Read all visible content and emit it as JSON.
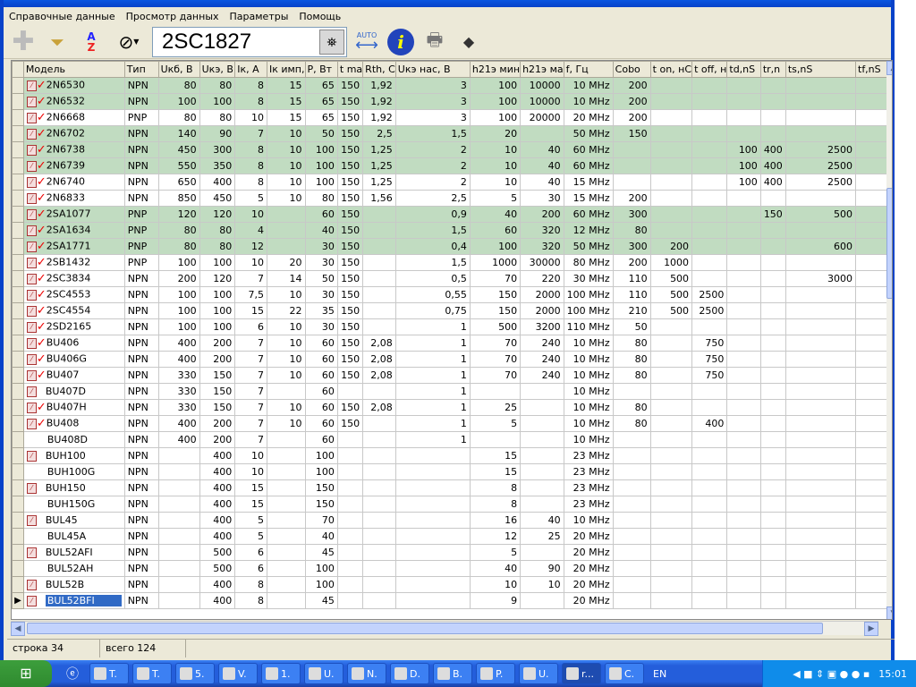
{
  "menu": [
    "Справочные данные",
    "Просмотр данных",
    "Параметры",
    "Помощь"
  ],
  "search": {
    "value": "2SC1827"
  },
  "toolbar": {
    "auto_label": "AUTO"
  },
  "columns": [
    "Модель",
    "Тип",
    "Uкб, В",
    "Uкэ, В",
    "Iк, А",
    "Iк имп,",
    "P, Вт",
    "t ma",
    "Rth, C",
    "Uкэ нас, В",
    "h21э мин",
    "h21э ма",
    "f, Гц",
    "Cobo",
    "t on, нС",
    "t off, н",
    "td,nS",
    "tr,n",
    "ts,nS",
    "tf,nS"
  ],
  "rows": [
    {
      "g": 1,
      "pdf": 1,
      "chk": 1,
      "c": [
        "2N6530",
        "NPN",
        "80",
        "80",
        "8",
        "15",
        "65",
        "150",
        "1,92",
        "3",
        "100",
        "10000",
        "10 MHz",
        "200",
        "",
        "",
        "",
        "",
        "",
        ""
      ]
    },
    {
      "g": 1,
      "pdf": 1,
      "chk": 1,
      "c": [
        "2N6532",
        "NPN",
        "100",
        "100",
        "8",
        "15",
        "65",
        "150",
        "1,92",
        "3",
        "100",
        "10000",
        "10 MHz",
        "200",
        "",
        "",
        "",
        "",
        "",
        ""
      ]
    },
    {
      "g": 0,
      "pdf": 1,
      "chk": 1,
      "c": [
        "2N6668",
        "PNP",
        "80",
        "80",
        "10",
        "15",
        "65",
        "150",
        "1,92",
        "3",
        "100",
        "20000",
        "20 MHz",
        "200",
        "",
        "",
        "",
        "",
        "",
        ""
      ]
    },
    {
      "g": 1,
      "pdf": 1,
      "chk": 1,
      "c": [
        "2N6702",
        "NPN",
        "140",
        "90",
        "7",
        "10",
        "50",
        "150",
        "2,5",
        "1,5",
        "20",
        "",
        "50 MHz",
        "150",
        "",
        "",
        "",
        "",
        "",
        ""
      ]
    },
    {
      "g": 1,
      "pdf": 1,
      "chk": 1,
      "c": [
        "2N6738",
        "NPN",
        "450",
        "300",
        "8",
        "10",
        "100",
        "150",
        "1,25",
        "2",
        "10",
        "40",
        "60 MHz",
        "",
        "",
        "",
        "100",
        "400",
        "2500",
        ""
      ]
    },
    {
      "g": 1,
      "pdf": 1,
      "chk": 1,
      "c": [
        "2N6739",
        "NPN",
        "550",
        "350",
        "8",
        "10",
        "100",
        "150",
        "1,25",
        "2",
        "10",
        "40",
        "60 MHz",
        "",
        "",
        "",
        "100",
        "400",
        "2500",
        ""
      ]
    },
    {
      "g": 0,
      "pdf": 1,
      "chk": 1,
      "c": [
        "2N6740",
        "NPN",
        "650",
        "400",
        "8",
        "10",
        "100",
        "150",
        "1,25",
        "2",
        "10",
        "40",
        "15 MHz",
        "",
        "",
        "",
        "100",
        "400",
        "2500",
        ""
      ]
    },
    {
      "g": 0,
      "pdf": 1,
      "chk": 1,
      "c": [
        "2N6833",
        "NPN",
        "850",
        "450",
        "5",
        "10",
        "80",
        "150",
        "1,56",
        "2,5",
        "5",
        "30",
        "15 MHz",
        "200",
        "",
        "",
        "",
        "",
        "",
        ""
      ]
    },
    {
      "g": 1,
      "pdf": 1,
      "chk": 1,
      "c": [
        "2SA1077",
        "PNP",
        "120",
        "120",
        "10",
        "",
        "60",
        "150",
        "",
        "0,9",
        "40",
        "200",
        "60 MHz",
        "300",
        "",
        "",
        "",
        "150",
        "500",
        ""
      ]
    },
    {
      "g": 1,
      "pdf": 1,
      "chk": 1,
      "c": [
        "2SA1634",
        "PNP",
        "80",
        "80",
        "4",
        "",
        "40",
        "150",
        "",
        "1,5",
        "60",
        "320",
        "12 MHz",
        "80",
        "",
        "",
        "",
        "",
        "",
        ""
      ]
    },
    {
      "g": 1,
      "pdf": 1,
      "chk": 1,
      "c": [
        "2SA1771",
        "PNP",
        "80",
        "80",
        "12",
        "",
        "30",
        "150",
        "",
        "0,4",
        "100",
        "320",
        "50 MHz",
        "300",
        "200",
        "",
        "",
        "",
        "600",
        ""
      ]
    },
    {
      "g": 0,
      "pdf": 1,
      "chk": 1,
      "c": [
        "2SB1432",
        "PNP",
        "100",
        "100",
        "10",
        "20",
        "30",
        "150",
        "",
        "1,5",
        "1000",
        "30000",
        "80 MHz",
        "200",
        "1000",
        "",
        "",
        "",
        "",
        ""
      ]
    },
    {
      "g": 0,
      "pdf": 1,
      "chk": 1,
      "c": [
        "2SC3834",
        "NPN",
        "200",
        "120",
        "7",
        "14",
        "50",
        "150",
        "",
        "0,5",
        "70",
        "220",
        "30 MHz",
        "110",
        "500",
        "",
        "",
        "",
        "3000",
        ""
      ]
    },
    {
      "g": 0,
      "pdf": 1,
      "chk": 1,
      "c": [
        "2SC4553",
        "NPN",
        "100",
        "100",
        "7,5",
        "10",
        "30",
        "150",
        "",
        "0,55",
        "150",
        "2000",
        "100 MHz",
        "110",
        "500",
        "2500",
        "",
        "",
        "",
        ""
      ]
    },
    {
      "g": 0,
      "pdf": 1,
      "chk": 1,
      "c": [
        "2SC4554",
        "NPN",
        "100",
        "100",
        "15",
        "22",
        "35",
        "150",
        "",
        "0,75",
        "150",
        "2000",
        "100 MHz",
        "210",
        "500",
        "2500",
        "",
        "",
        "",
        ""
      ]
    },
    {
      "g": 0,
      "pdf": 1,
      "chk": 1,
      "c": [
        "2SD2165",
        "NPN",
        "100",
        "100",
        "6",
        "10",
        "30",
        "150",
        "",
        "1",
        "500",
        "3200",
        "110 MHz",
        "50",
        "",
        "",
        "",
        "",
        "",
        ""
      ]
    },
    {
      "g": 0,
      "pdf": 1,
      "chk": 1,
      "c": [
        "BU406",
        "NPN",
        "400",
        "200",
        "7",
        "10",
        "60",
        "150",
        "2,08",
        "1",
        "70",
        "240",
        "10 MHz",
        "80",
        "",
        "750",
        "",
        "",
        "",
        ""
      ]
    },
    {
      "g": 0,
      "pdf": 1,
      "chk": 1,
      "c": [
        "BU406G",
        "NPN",
        "400",
        "200",
        "7",
        "10",
        "60",
        "150",
        "2,08",
        "1",
        "70",
        "240",
        "10 MHz",
        "80",
        "",
        "750",
        "",
        "",
        "",
        ""
      ]
    },
    {
      "g": 0,
      "pdf": 1,
      "chk": 1,
      "c": [
        "BU407",
        "NPN",
        "330",
        "150",
        "7",
        "10",
        "60",
        "150",
        "2,08",
        "1",
        "70",
        "240",
        "10 MHz",
        "80",
        "",
        "750",
        "",
        "",
        "",
        ""
      ]
    },
    {
      "g": 0,
      "pdf": 1,
      "chk": 0,
      "c": [
        "BU407D",
        "NPN",
        "330",
        "150",
        "7",
        "",
        "60",
        "",
        "",
        "1",
        "",
        "",
        "10 MHz",
        "",
        "",
        "",
        "",
        "",
        "",
        ""
      ]
    },
    {
      "g": 0,
      "pdf": 1,
      "chk": 1,
      "c": [
        "BU407H",
        "NPN",
        "330",
        "150",
        "7",
        "10",
        "60",
        "150",
        "2,08",
        "1",
        "25",
        "",
        "10 MHz",
        "80",
        "",
        "",
        "",
        "",
        "",
        ""
      ]
    },
    {
      "g": 0,
      "pdf": 1,
      "chk": 1,
      "c": [
        "BU408",
        "NPN",
        "400",
        "200",
        "7",
        "10",
        "60",
        "150",
        "",
        "1",
        "5",
        "",
        "10 MHz",
        "80",
        "",
        "400",
        "",
        "",
        "",
        ""
      ]
    },
    {
      "g": 0,
      "pdf": 0,
      "chk": 0,
      "c": [
        "BU408D",
        "NPN",
        "400",
        "200",
        "7",
        "",
        "60",
        "",
        "",
        "1",
        "",
        "",
        "10 MHz",
        "",
        "",
        "",
        "",
        "",
        "",
        ""
      ]
    },
    {
      "g": 0,
      "pdf": 1,
      "chk": 0,
      "c": [
        "BUH100",
        "NPN",
        "",
        "400",
        "10",
        "",
        "100",
        "",
        "",
        "",
        "15",
        "",
        "23 MHz",
        "",
        "",
        "",
        "",
        "",
        "",
        ""
      ]
    },
    {
      "g": 0,
      "pdf": 0,
      "chk": 0,
      "c": [
        "BUH100G",
        "NPN",
        "",
        "400",
        "10",
        "",
        "100",
        "",
        "",
        "",
        "15",
        "",
        "23 MHz",
        "",
        "",
        "",
        "",
        "",
        "",
        ""
      ]
    },
    {
      "g": 0,
      "pdf": 1,
      "chk": 0,
      "c": [
        "BUH150",
        "NPN",
        "",
        "400",
        "15",
        "",
        "150",
        "",
        "",
        "",
        "8",
        "",
        "23 MHz",
        "",
        "",
        "",
        "",
        "",
        "",
        ""
      ]
    },
    {
      "g": 0,
      "pdf": 0,
      "chk": 0,
      "c": [
        "BUH150G",
        "NPN",
        "",
        "400",
        "15",
        "",
        "150",
        "",
        "",
        "",
        "8",
        "",
        "23 MHz",
        "",
        "",
        "",
        "",
        "",
        "",
        ""
      ]
    },
    {
      "g": 0,
      "pdf": 1,
      "chk": 0,
      "c": [
        "BUL45",
        "NPN",
        "",
        "400",
        "5",
        "",
        "70",
        "",
        "",
        "",
        "16",
        "40",
        "10 MHz",
        "",
        "",
        "",
        "",
        "",
        "",
        ""
      ]
    },
    {
      "g": 0,
      "pdf": 0,
      "chk": 0,
      "c": [
        "BUL45A",
        "NPN",
        "",
        "400",
        "5",
        "",
        "40",
        "",
        "",
        "",
        "12",
        "25",
        "20 MHz",
        "",
        "",
        "",
        "",
        "",
        "",
        ""
      ]
    },
    {
      "g": 0,
      "pdf": 1,
      "chk": 0,
      "c": [
        "BUL52AFI",
        "NPN",
        "",
        "500",
        "6",
        "",
        "45",
        "",
        "",
        "",
        "5",
        "",
        "20 MHz",
        "",
        "",
        "",
        "",
        "",
        "",
        ""
      ]
    },
    {
      "g": 0,
      "pdf": 0,
      "chk": 0,
      "c": [
        "BUL52AH",
        "NPN",
        "",
        "500",
        "6",
        "",
        "100",
        "",
        "",
        "",
        "40",
        "90",
        "20 MHz",
        "",
        "",
        "",
        "",
        "",
        "",
        ""
      ]
    },
    {
      "g": 0,
      "pdf": 1,
      "chk": 0,
      "c": [
        "BUL52B",
        "NPN",
        "",
        "400",
        "8",
        "",
        "100",
        "",
        "",
        "",
        "10",
        "10",
        "20 MHz",
        "",
        "",
        "",
        "",
        "",
        "",
        ""
      ]
    },
    {
      "g": 0,
      "pdf": 1,
      "chk": 0,
      "sel": 1,
      "c": [
        "BUL52BFI",
        "NPN",
        "",
        "400",
        "8",
        "",
        "45",
        "",
        "",
        "",
        "9",
        "",
        "20 MHz",
        "",
        "",
        "",
        "",
        "",
        "",
        ""
      ]
    }
  ],
  "status": {
    "row": "строка 34",
    "total": "всего 124"
  },
  "taskbar": {
    "items": [
      "T.",
      "T.",
      "5.",
      "V.",
      "1.",
      "U.",
      "N.",
      "D.",
      "B.",
      "P.",
      "U.",
      "r...",
      "C."
    ],
    "lang": "EN",
    "clock": "15:01"
  },
  "colors": {
    "green_row": "#c1dcc1",
    "selection": "#316ac5",
    "taskbar": "#245edb"
  }
}
